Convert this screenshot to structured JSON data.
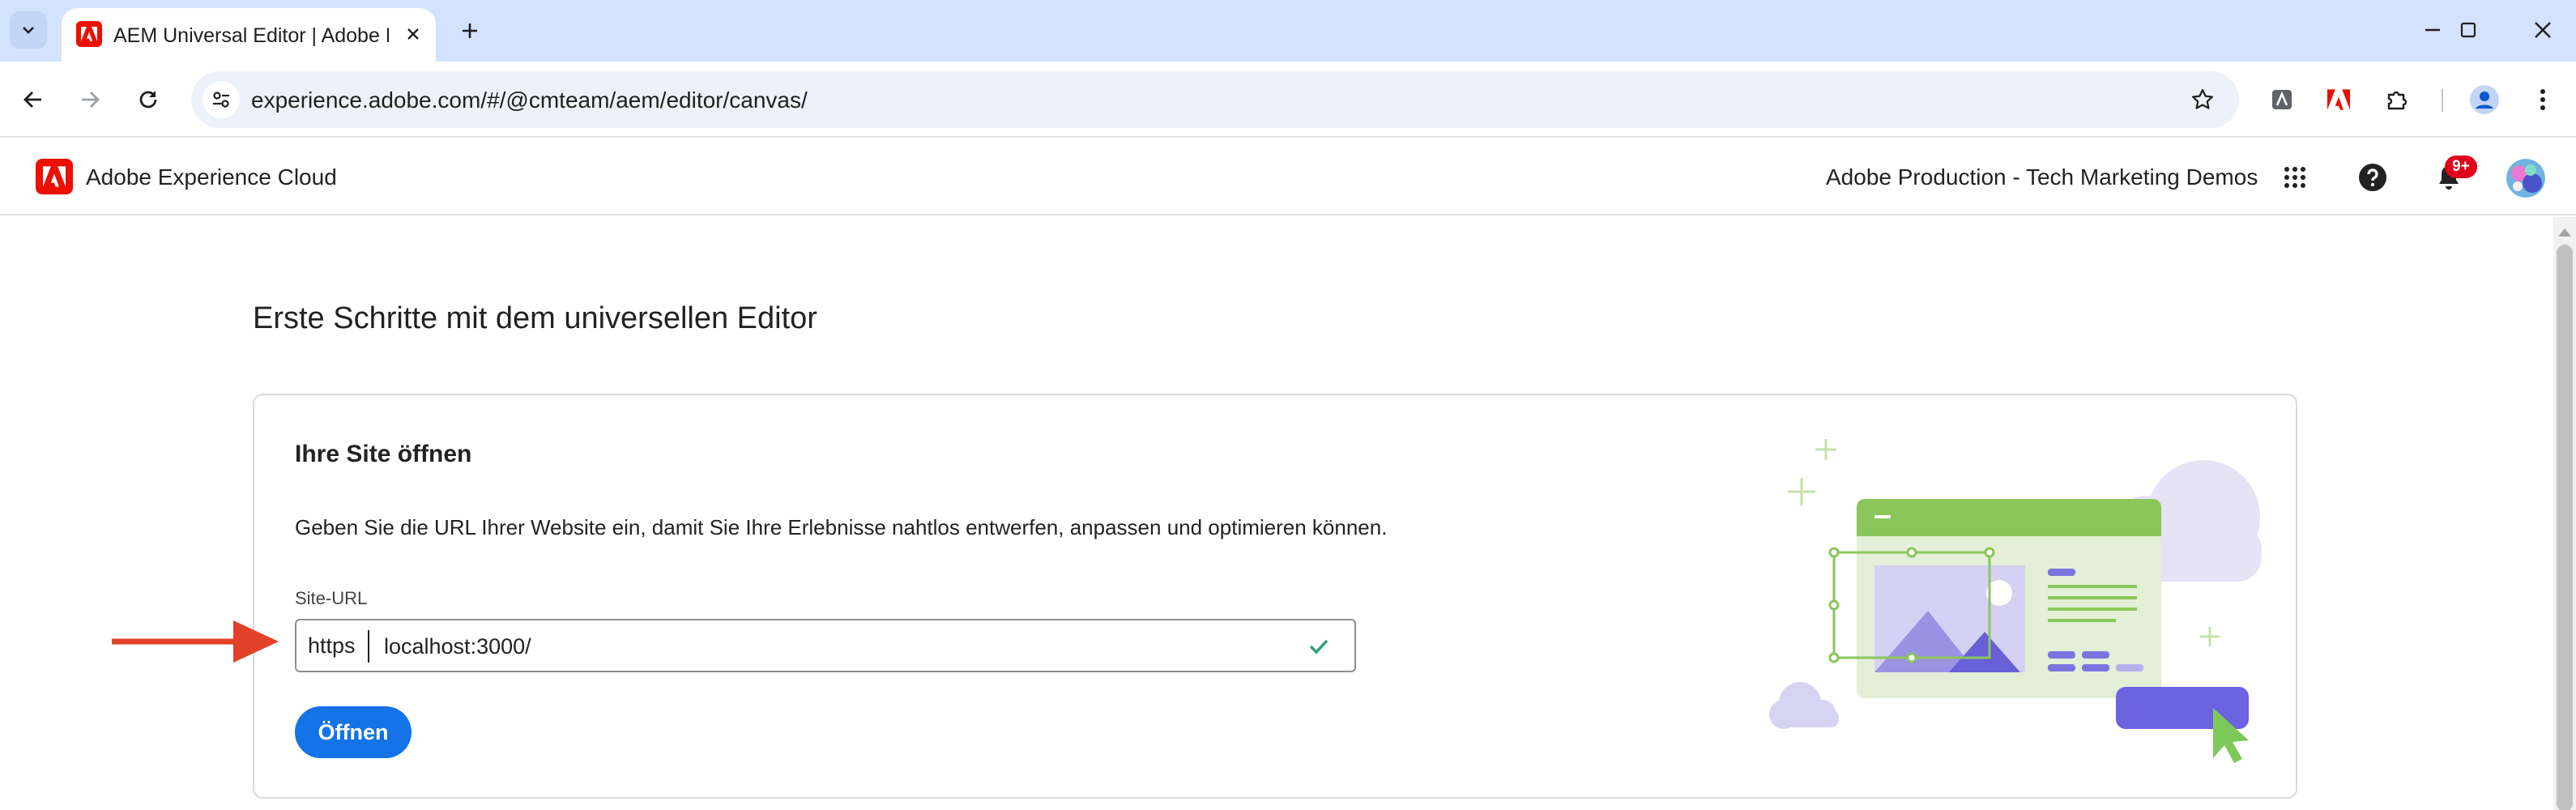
{
  "browser": {
    "tab_title": "AEM Universal Editor | Adobe Experience Manager",
    "url": "experience.adobe.com/#/@cmteam/aem/editor/canvas/",
    "icons": [
      "tab-list-icon",
      "close-icon",
      "plus-icon",
      "minimize-icon",
      "maximize-icon",
      "close-window-icon",
      "back-icon",
      "forward-icon",
      "reload-icon",
      "site-settings-icon",
      "star-icon",
      "extension-icon",
      "acrobat-icon",
      "puzzle-icon",
      "profile-icon",
      "kebab-menu-icon"
    ]
  },
  "shell": {
    "brand": "Adobe Experience Cloud",
    "org": "Adobe Production - Tech Marketing Demos",
    "notification_count": "9+",
    "accent_color": "#eb1000"
  },
  "page": {
    "title": "Erste Schritte mit dem universellen Editor",
    "card": {
      "heading": "Ihre Site öffnen",
      "description": "Geben Sie die URL Ihrer Website ein, damit Sie Ihre Erlebnisse nahtlos entwerfen, anpassen und optimieren können.",
      "field_label": "Site-URL",
      "scheme": "https",
      "url_value": "localhost:3000/",
      "open_button": "Öffnen"
    }
  },
  "colors": {
    "primary_button": "#1473e6",
    "valid_check": "#2d9d78",
    "annotation_arrow": "#e3402a"
  }
}
